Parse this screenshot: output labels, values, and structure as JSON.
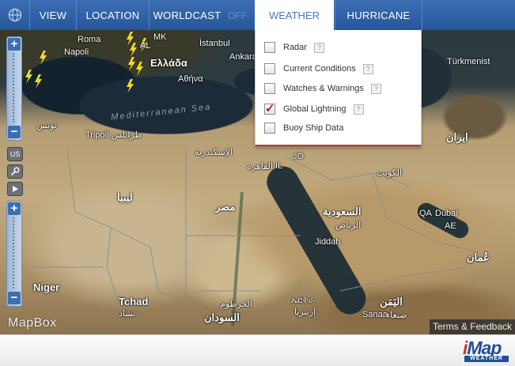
{
  "nav": {
    "items": [
      {
        "id": "view",
        "label": "VIEW"
      },
      {
        "id": "location",
        "label": "LOCATION"
      },
      {
        "id": "worldcast",
        "label": "WORLDCAST"
      },
      {
        "id": "hurricane",
        "label": "HURRICANE"
      }
    ],
    "worldcast_toggle": "OFF",
    "active_tab": "WEATHER"
  },
  "weather_menu": {
    "items": [
      {
        "label": "Radar",
        "checked": false
      },
      {
        "label": "Current Conditions",
        "checked": false
      },
      {
        "label": "Watches & Warnings",
        "checked": false
      },
      {
        "label": "Global Lightning",
        "checked": true
      },
      {
        "label": "Buoy Ship Data",
        "checked": false
      }
    ],
    "help_glyph": "?"
  },
  "map_controls": {
    "zoom_in": "+",
    "zoom_out": "−",
    "us_label": "US"
  },
  "map_labels": {
    "roma": "Roma",
    "napoli": "Napoli",
    "al": "AL",
    "mk": "MK",
    "istanbul": "İstanbul",
    "ellada": "Ελλάδα",
    "athina": "Αθήνα",
    "ankara": "Ankara",
    "turkmenistan": "Türkmenist",
    "mediterranean": "Mediterranean Sea",
    "tunis": "تونس",
    "tripoli": "Tripoli طرابلس",
    "alexandria": "الإسكندرية",
    "cairo": "القاهرة",
    "il": "IL",
    "jo": "JO",
    "kuwait": "الكويت",
    "iran": "ایران",
    "libya": "ليبيا",
    "egypt": "مصر",
    "saudi": "السعودية",
    "riyadh": "الرياض",
    "qa": "QA",
    "dubai": "Dubai",
    "ae": "AE",
    "jiddah": "Jiddah",
    "oman": "عُمان",
    "niger": "Niger",
    "tchad": "Tchad",
    "tchad_ar": "تشاد",
    "khartoum": "الخرطوم",
    "sudan": "السودان",
    "eritrea": "ኤርትራ",
    "eritrea_ar": "إريتريا",
    "yemen": "اليَمَن",
    "sanaa": "Sanaa",
    "sanaa_ar": "صنعاء"
  },
  "attribution": {
    "mapbox": "MapBox",
    "terms": "Terms & Feedback"
  },
  "footer": {
    "logo_main": "Map",
    "logo_i": "i",
    "logo_sub": "WEATHER"
  },
  "colors": {
    "nav_bg": "#2f62a9",
    "active_tab_text": "#4a79bc",
    "check_red": "#c0141c",
    "lightning": "#f2dc2e"
  }
}
